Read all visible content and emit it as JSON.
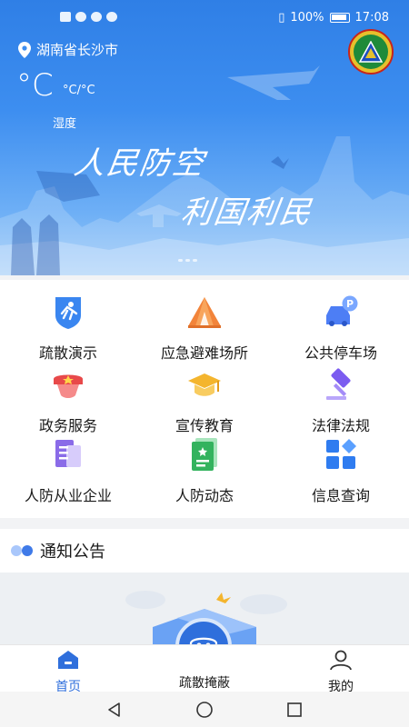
{
  "status_bar": {
    "battery": "100%",
    "time": "17:08"
  },
  "weather": {
    "location": "湖南省长沙市",
    "temperature": "°C",
    "temp_range": "°C/°C",
    "humidity_label": "湿度"
  },
  "banner": {
    "slogan_line1": "人民防空",
    "slogan_line2": "利国利民"
  },
  "menu": [
    {
      "label": "疏散演示",
      "icon": "evacuation-run-icon"
    },
    {
      "label": "应急避难场所",
      "icon": "tent-icon"
    },
    {
      "label": "公共停车场",
      "icon": "parking-car-icon"
    },
    {
      "label": "政务服务",
      "icon": "cap-icon"
    },
    {
      "label": "宣传教育",
      "icon": "graduation-cap-icon"
    },
    {
      "label": "法律法规",
      "icon": "gavel-icon"
    },
    {
      "label": "人防从业企业",
      "icon": "document-icon"
    },
    {
      "label": "人防动态",
      "icon": "news-icon"
    },
    {
      "label": "信息查询",
      "icon": "grid-search-icon"
    }
  ],
  "notice": {
    "title": "通知公告"
  },
  "tabbar": {
    "home": "首页",
    "shelter": "疏散掩蔽",
    "mine": "我的"
  },
  "colors": {
    "accent": "#2f6fdc",
    "banner_top": "#2f7fe6",
    "text": "#1a1a1a"
  }
}
